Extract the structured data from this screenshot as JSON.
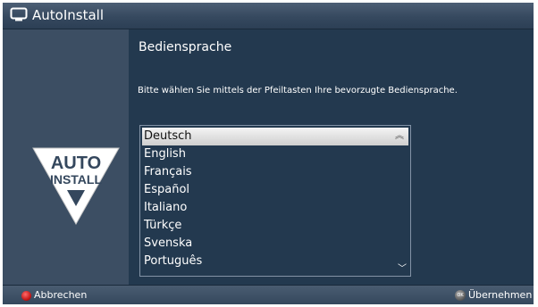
{
  "window": {
    "title": "AutoInstall",
    "icon": "tv-icon"
  },
  "logo": {
    "line1": "AUTO",
    "line2": "INSTALL",
    "icon": "autoinstall-logo-icon"
  },
  "content": {
    "heading": "Bediensprache",
    "instruction": "Bitte wählen Sie mittels der Pfeiltasten Ihre bevorzugte Bediensprache."
  },
  "languages": {
    "selected": "Deutsch",
    "items": [
      "Deutsch",
      "English",
      "Français",
      "Español",
      "Italiano",
      "Türkçe",
      "Svenska",
      "Português"
    ],
    "scroll_up_icon": "chevron-double-up-icon",
    "scroll_down_icon": "chevron-down-icon"
  },
  "footer": {
    "cancel_label": "Abbrechen",
    "cancel_icon": "red-button-icon",
    "accept_label": "Übernehmen",
    "accept_icon": "ok-button-icon",
    "ok_text": "OK"
  },
  "colors": {
    "background": "#23394f",
    "left_panel": "#3c4e63",
    "selection": "#e6e6e6",
    "red_button": "#d01818"
  }
}
